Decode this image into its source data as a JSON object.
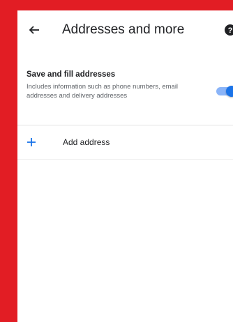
{
  "header": {
    "title": "Addresses and more",
    "back_icon": "arrow-back-icon",
    "help_icon": "help-icon"
  },
  "setting": {
    "title": "Save and fill addresses",
    "description": "Includes information such as phone numbers, email addresses and delivery addresses",
    "enabled": true
  },
  "add_address": {
    "label": "Add address",
    "icon": "plus-icon"
  },
  "colors": {
    "frame": "#e21d24",
    "accent": "#1a73e8",
    "track": "#8ab4f8",
    "text": "#202124",
    "secondary_text": "#5f6368"
  }
}
